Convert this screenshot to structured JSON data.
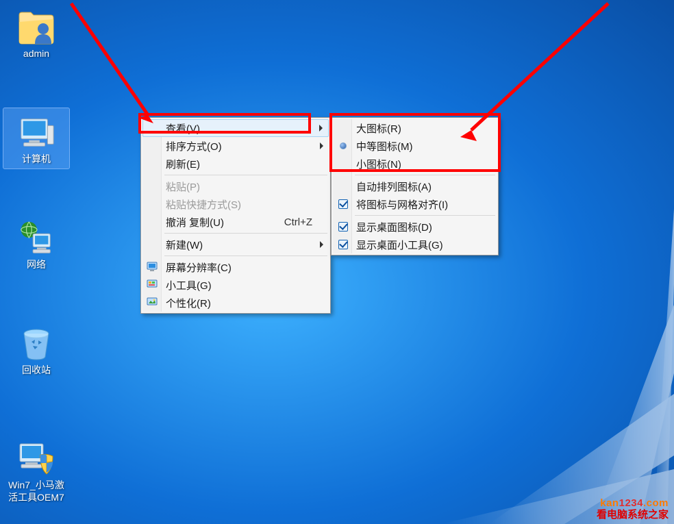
{
  "desktop_icons": {
    "admin": {
      "label": "admin"
    },
    "computer": {
      "label": "计算机"
    },
    "network": {
      "label": "网络"
    },
    "recycle": {
      "label": "回收站"
    },
    "tool": {
      "label": "Win7_小马激活工具OEM7"
    }
  },
  "context_menu": {
    "view": {
      "label": "查看(V)"
    },
    "sort": {
      "label": "排序方式(O)"
    },
    "refresh": {
      "label": "刷新(E)"
    },
    "paste": {
      "label": "粘贴(P)"
    },
    "paste_shortcut": {
      "label": "粘贴快捷方式(S)"
    },
    "undo_copy": {
      "label": "撤消 复制(U)",
      "shortcut": "Ctrl+Z"
    },
    "new": {
      "label": "新建(W)"
    },
    "resolution": {
      "label": "屏幕分辨率(C)"
    },
    "gadgets": {
      "label": "小工具(G)"
    },
    "personalize": {
      "label": "个性化(R)"
    }
  },
  "view_submenu": {
    "large": {
      "label": "大图标(R)",
      "checked": false
    },
    "medium": {
      "label": "中等图标(M)",
      "checked": true
    },
    "small": {
      "label": "小图标(N)",
      "checked": false
    },
    "auto": {
      "label": "自动排列图标(A)",
      "checked": false
    },
    "align": {
      "label": "将图标与网格对齐(I)",
      "checked": true
    },
    "show_icons": {
      "label": "显示桌面图标(D)",
      "checked": true
    },
    "show_gadg": {
      "label": "显示桌面小工具(G)",
      "checked": true
    }
  },
  "watermark": {
    "line1_prefix": "kan",
    "line1_num": "1234",
    "line1_suffix": ".com",
    "line2": "看电脑系统之家"
  }
}
